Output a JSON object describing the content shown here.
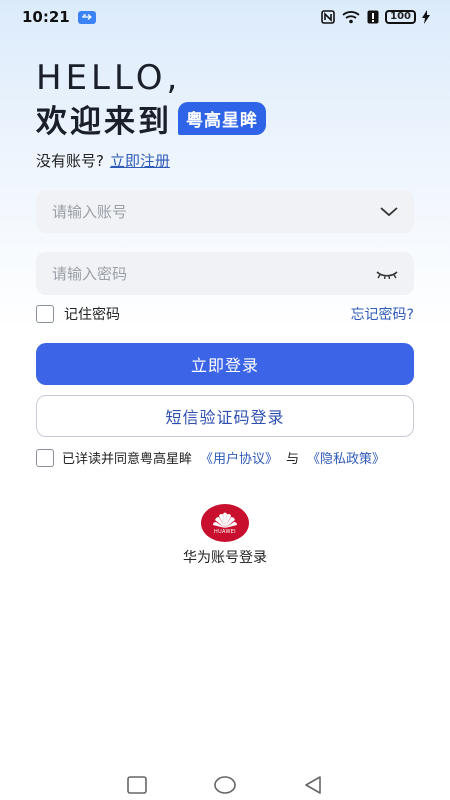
{
  "status_bar": {
    "time": "10:21",
    "battery": "100",
    "icons": [
      "usb-icon",
      "nfc-icon",
      "wifi-icon",
      "alert-icon",
      "battery-icon",
      "charging-icon"
    ]
  },
  "header": {
    "hello": "HELLO,",
    "welcome": "欢迎来到",
    "brand": "粤高星眸"
  },
  "register": {
    "prompt": "没有账号?",
    "link": "立即注册"
  },
  "form": {
    "username_placeholder": "请输入账号",
    "password_placeholder": "请输入密码",
    "remember_label": "记住密码",
    "forgot_label": "忘记密码?"
  },
  "buttons": {
    "login": "立即登录",
    "sms_login": "短信验证码登录"
  },
  "agreement": {
    "prefix": "已详读并同意粤高星眸",
    "user_agreement": "《用户协议》",
    "and": "与",
    "privacy_policy": "《隐私政策》"
  },
  "huawei": {
    "logo_text": "HUAWEI",
    "label": "华为账号登录"
  },
  "colors": {
    "primary": "#3b64e6",
    "link": "#2f5bb8",
    "huawei_red": "#c8102e"
  }
}
